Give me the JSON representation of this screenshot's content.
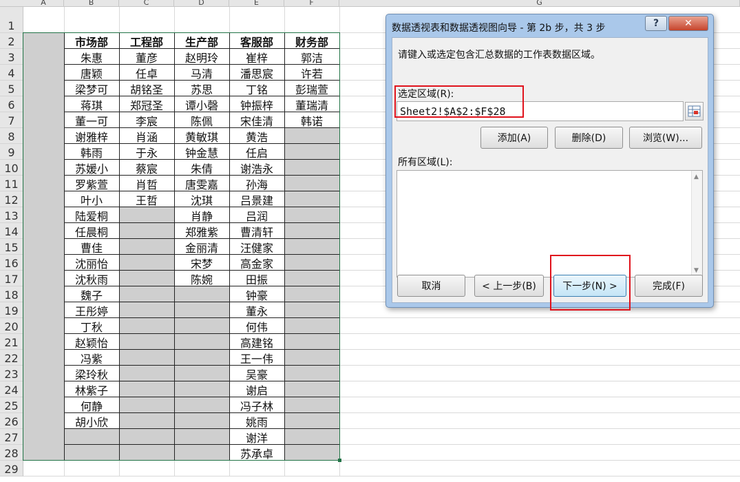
{
  "sheet": {
    "columns": [
      "A",
      "B",
      "C",
      "D",
      "E",
      "F",
      "G"
    ],
    "rows": [
      "1",
      "2",
      "3",
      "4",
      "5",
      "6",
      "7",
      "8",
      "9",
      "10",
      "11",
      "12",
      "13",
      "14",
      "15",
      "16",
      "17",
      "18",
      "19",
      "20",
      "21",
      "22",
      "23",
      "24",
      "25",
      "26",
      "27",
      "28",
      "29"
    ],
    "table": {
      "headers": [
        "市场部",
        "工程部",
        "生产部",
        "客服部",
        "财务部"
      ],
      "body": [
        [
          "朱惠",
          "董彦",
          "赵明玲",
          "崔梓",
          "郭洁"
        ],
        [
          "唐颖",
          "任卓",
          "马清",
          "潘思宸",
          "许若"
        ],
        [
          "梁梦可",
          "胡铭圣",
          "苏思",
          "丁铭",
          "彭瑞萱"
        ],
        [
          "蒋琪",
          "郑冠圣",
          "谭小磬",
          "钟振梓",
          "董瑞清"
        ],
        [
          "董一可",
          "李宸",
          "陈佩",
          "宋佳清",
          "韩诺"
        ],
        [
          "谢雅梓",
          "肖涵",
          "黄敏琪",
          "黄浩",
          ""
        ],
        [
          "韩雨",
          "于永",
          "钟金慧",
          "任启",
          ""
        ],
        [
          "苏媛小",
          "蔡宸",
          "朱倩",
          "谢浩永",
          ""
        ],
        [
          "罗紫萱",
          "肖哲",
          "唐雯嘉",
          "孙海",
          ""
        ],
        [
          "叶小",
          "王哲",
          "沈琪",
          "吕景建",
          ""
        ],
        [
          "陆爱桐",
          "",
          "肖静",
          "吕润",
          ""
        ],
        [
          "任晨桐",
          "",
          "郑雅紫",
          "曹清轩",
          ""
        ],
        [
          "曹佳",
          "",
          "金丽清",
          "汪健家",
          ""
        ],
        [
          "沈丽怡",
          "",
          "宋梦",
          "高金家",
          ""
        ],
        [
          "沈秋雨",
          "",
          "陈婉",
          "田振",
          ""
        ],
        [
          "魏子",
          "",
          "",
          "钟豪",
          ""
        ],
        [
          "王彤婷",
          "",
          "",
          "董永",
          ""
        ],
        [
          "丁秋",
          "",
          "",
          "何伟",
          ""
        ],
        [
          "赵颖怡",
          "",
          "",
          "高建铭",
          ""
        ],
        [
          "冯紫",
          "",
          "",
          "王一伟",
          ""
        ],
        [
          "梁玲秋",
          "",
          "",
          "吴豪",
          ""
        ],
        [
          "林紫子",
          "",
          "",
          "谢启",
          ""
        ],
        [
          "何静",
          "",
          "",
          "冯子林",
          ""
        ],
        [
          "胡小欣",
          "",
          "",
          "姚雨",
          ""
        ],
        [
          "",
          "",
          "",
          "谢洋",
          ""
        ],
        [
          "",
          "",
          "",
          "苏承卓",
          ""
        ]
      ]
    }
  },
  "dialog": {
    "title": "数据透视表和数据透视图向导 - 第 2b 步，共 3 步",
    "help_label": "?",
    "close_label": "✕",
    "instruction": "请键入或选定包含汇总数据的工作表数据区域。",
    "range_label": "选定区域(R):",
    "range_value": "Sheet2!$A$2:$F$28",
    "add_button": "添加(A)",
    "delete_button": "删除(D)",
    "browse_button": "浏览(W)...",
    "all_ranges_label": "所有区域(L):",
    "cancel_button": "取消",
    "back_button": "< 上一步(B)",
    "next_button": "下一步(N) >",
    "finish_button": "完成(F)"
  }
}
